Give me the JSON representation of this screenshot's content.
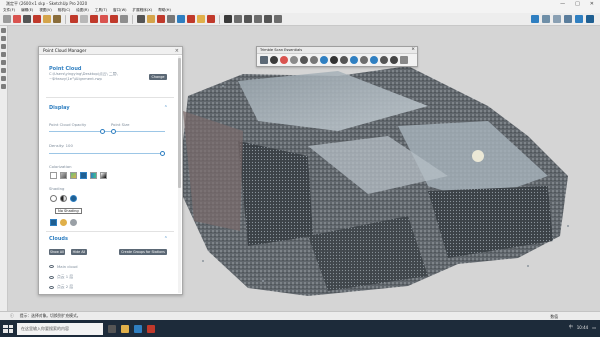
{
  "window": {
    "title": "測定平 (2600×1 skp - SketchUp Pro 2020",
    "controls": [
      "minimize",
      "maximize",
      "close"
    ]
  },
  "menubar": [
    "文件(F)",
    "编辑(E)",
    "视图(V)",
    "相机(C)",
    "绘图(R)",
    "工具(T)",
    "窗口(W)",
    "扩展程序(X)",
    "帮助(H)"
  ],
  "panel": {
    "title": "Point Cloud Manager",
    "close": "×",
    "section_point_cloud": "Point Cloud",
    "path_line1": "C:\\Users\\yingying\\Desktop\\点云\\ 二层\\",
    "path_line2": "~$Heavy\\1e\"\\Alignment.rwp",
    "change_button": "Change",
    "section_display": "Display",
    "opacity_label": "Point Cloud Opacity",
    "point_size_label": "Point Size",
    "density_label": "Density: 100",
    "colorization_label": "Colorization",
    "shading_label": "Shading",
    "tooltip": "No Shading",
    "section_clouds": "Clouds",
    "show_all": "Show All",
    "hide_all": "Hide All",
    "create_groups": "Create Groups for Stations",
    "clouds": [
      "Main cloud",
      "点云 1 层",
      "点云 2 层"
    ],
    "opacity": 0.45,
    "point_size": 0.45,
    "density": 1.0
  },
  "scanbar": {
    "title": "Trimble Scan Essentials",
    "close": "×"
  },
  "statusbar": {
    "hint": "提示：选择对象。切换到扩充模式。",
    "measure_label": "数值"
  },
  "taskbar": {
    "search_placeholder": "在这里输入你要搜索的内容",
    "time": "10:44",
    "lang": "中"
  },
  "colors": {
    "accent": "#2f7fc1",
    "panel_button": "#5b6875",
    "taskbar": "#1d2b3a"
  }
}
